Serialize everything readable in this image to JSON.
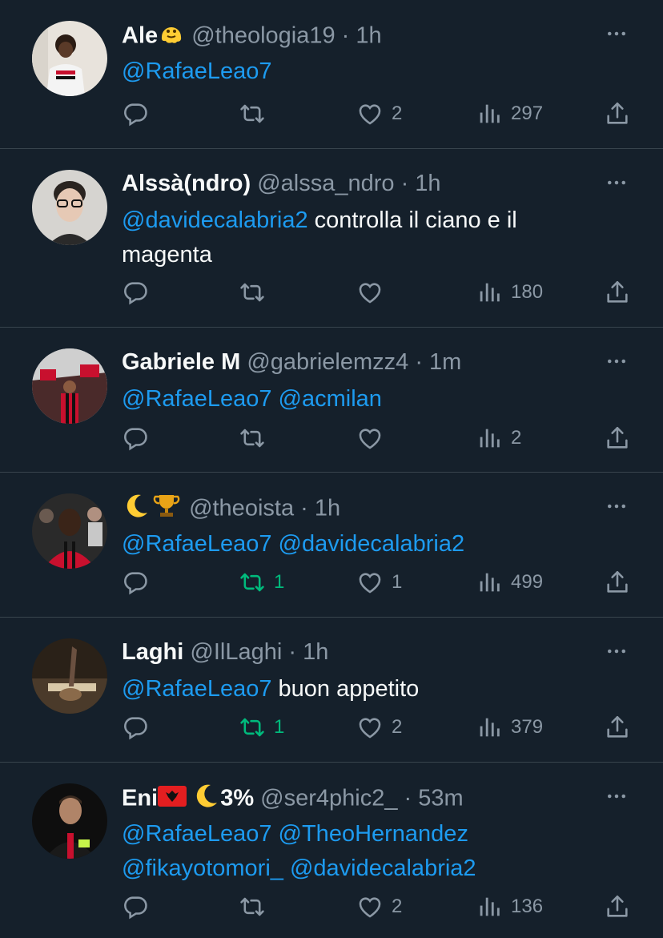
{
  "tweets": [
    {
      "name": "Ale",
      "handle": "@theologia19",
      "time": "1h",
      "mentions": [
        "@RafaeLeao7"
      ],
      "text": "",
      "stats": {
        "replies": "",
        "retweets": "",
        "likes": "2",
        "views": "297"
      },
      "retweeted": false
    },
    {
      "name": "Alssà(ndro)",
      "handle": "@alssa_ndro",
      "time": "1h",
      "mentions": [
        "@davidecalabria2"
      ],
      "text": "controlla il ciano e il magenta",
      "stats": {
        "replies": "",
        "retweets": "",
        "likes": "",
        "views": "180"
      },
      "retweeted": false
    },
    {
      "name": "Gabriele M",
      "handle": "@gabrielemzz4",
      "time": "1m",
      "mentions": [
        "@RafaeLeao7",
        "@acmilan"
      ],
      "text": "",
      "stats": {
        "replies": "",
        "retweets": "",
        "likes": "",
        "views": "2"
      },
      "retweeted": false
    },
    {
      "name": "",
      "handle": "@theoista",
      "time": "1h",
      "mentions": [
        "@RafaeLeao7",
        "@davidecalabria2"
      ],
      "text": "",
      "stats": {
        "replies": "",
        "retweets": "1",
        "likes": "1",
        "views": "499"
      },
      "retweeted": true
    },
    {
      "name": "Laghi",
      "handle": "@IlLaghi",
      "time": "1h",
      "mentions": [
        "@RafaeLeao7"
      ],
      "text": "buon appetito",
      "stats": {
        "replies": "",
        "retweets": "1",
        "likes": "2",
        "views": "379"
      },
      "retweeted": true
    },
    {
      "name": "Eni",
      "name_suffix": "3%",
      "handle": "@ser4phic2_",
      "time": "53m",
      "mentions_line1": [
        "@RafaeLeao7",
        "@TheoHernandez"
      ],
      "mentions_line2": [
        "@fikayotomori_",
        "@davidecalabria2"
      ],
      "text": "",
      "stats": {
        "replies": "",
        "retweets": "",
        "likes": "2",
        "views": "136"
      },
      "retweeted": false
    }
  ],
  "icons": {
    "reply": "reply-icon",
    "retweet": "retweet-icon",
    "like": "heart-icon",
    "views": "views-icon",
    "share": "share-icon",
    "more": "more-icon"
  },
  "colors": {
    "background": "#15202b",
    "text": "#f7f9f9",
    "muted": "#8b98a5",
    "link": "#1d9bf0",
    "retweet_active": "#00ba7c",
    "divider": "#38444d"
  }
}
